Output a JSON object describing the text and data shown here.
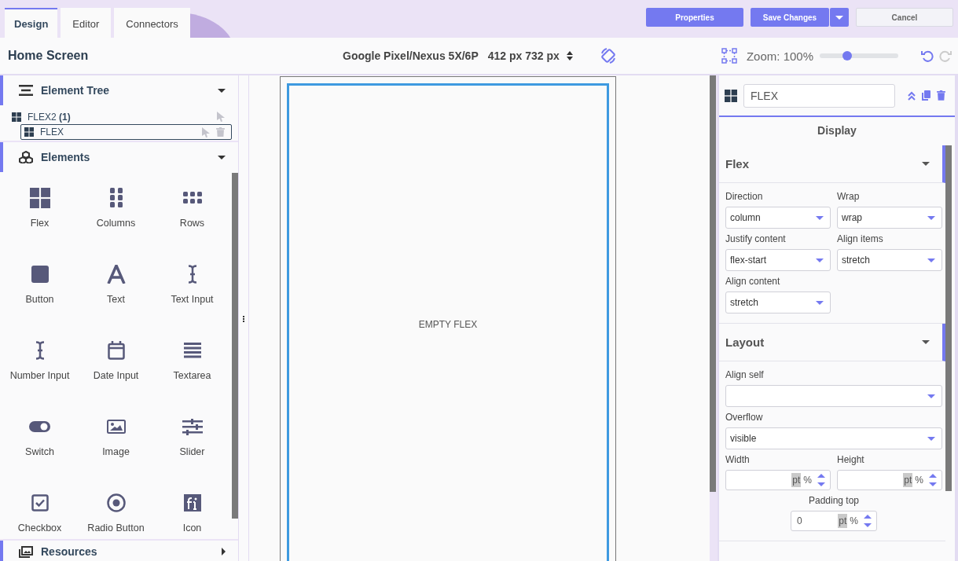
{
  "tabs": [
    {
      "label": "Design",
      "selected": true
    },
    {
      "label": "Editor",
      "selected": false
    },
    {
      "label": "Connectors",
      "selected": false
    }
  ],
  "actions": {
    "properties": "Properties",
    "save": "Save Changes",
    "cancel": "Cancel"
  },
  "toolbar": {
    "screen_title": "Home Screen",
    "device": "Google Pixel/Nexus 5X/6P",
    "dimensions": "412 px 732 px",
    "zoom_label": "Zoom: 100%",
    "zoom": {
      "level": 0.35
    },
    "undo": {
      "disabled": false
    },
    "redo": {
      "disabled": true
    }
  },
  "left_panel": {
    "sections": [
      {
        "kind": "tree",
        "title": "Element Tree",
        "expanded": true,
        "items": [
          {
            "label": "FLEX2 **(1)**",
            "selected": false,
            "children": [
              {
                "label": "FLEX",
                "selected": true
              }
            ]
          }
        ]
      },
      {
        "kind": "palette",
        "title": "Elements",
        "expanded": true,
        "items": [
          {
            "kind": "flex",
            "label": "Flex"
          },
          {
            "kind": "columns",
            "label": "Columns"
          },
          {
            "kind": "rows",
            "label": "Rows"
          },
          {
            "kind": "button",
            "label": "Button"
          },
          {
            "kind": "text",
            "label": "Text"
          },
          {
            "kind": "text_input",
            "label": "Text Input"
          },
          {
            "kind": "number_input",
            "label": "Number Input"
          },
          {
            "kind": "date_input",
            "label": "Date Input"
          },
          {
            "kind": "textarea",
            "label": "Textarea"
          },
          {
            "kind": "switch",
            "label": "Switch"
          },
          {
            "kind": "image",
            "label": "Image"
          },
          {
            "kind": "slider",
            "label": "Slider"
          },
          {
            "kind": "checkbox",
            "label": "Checkbox"
          },
          {
            "kind": "radio",
            "label": "Radio Button"
          },
          {
            "kind": "icon",
            "label": "Icon"
          }
        ]
      },
      {
        "kind": "resources",
        "title": "Resources",
        "expanded": false
      }
    ]
  },
  "canvas": {
    "empty_label": "EMPTY FLEX"
  },
  "right_panel": {
    "element_name": "FLEX",
    "tab": "Display",
    "sections": [
      {
        "title": "Flex",
        "expanded": true,
        "fields": [
          {
            "kind": "select",
            "label": "Direction",
            "value": "column"
          },
          {
            "kind": "select",
            "label": "Wrap",
            "value": "wrap"
          },
          {
            "kind": "select",
            "label": "Justify content",
            "value": "flex-start"
          },
          {
            "kind": "select",
            "label": "Align items",
            "value": "stretch"
          },
          {
            "kind": "select",
            "label": "Align content",
            "value": "stretch"
          }
        ]
      },
      {
        "title": "Layout",
        "expanded": true,
        "fields": [
          {
            "kind": "wide_select",
            "label": "Align self"
          },
          {
            "kind": "wide_select",
            "label": "Overflow",
            "value": "visible"
          },
          {
            "kind": "number",
            "label": "Width",
            "units": [
              {
                "label": "pt",
                "selected": true
              },
              {
                "label": "%",
                "selected": false
              }
            ]
          },
          {
            "kind": "number",
            "label": "Height",
            "units": [
              {
                "label": "pt",
                "selected": true
              },
              {
                "label": "%",
                "selected": false
              }
            ]
          },
          {
            "kind": "center_number",
            "label": "Padding top",
            "value": "0",
            "units": [
              {
                "label": "pt",
                "selected": true
              },
              {
                "label": "%",
                "selected": false
              }
            ]
          }
        ]
      }
    ]
  }
}
